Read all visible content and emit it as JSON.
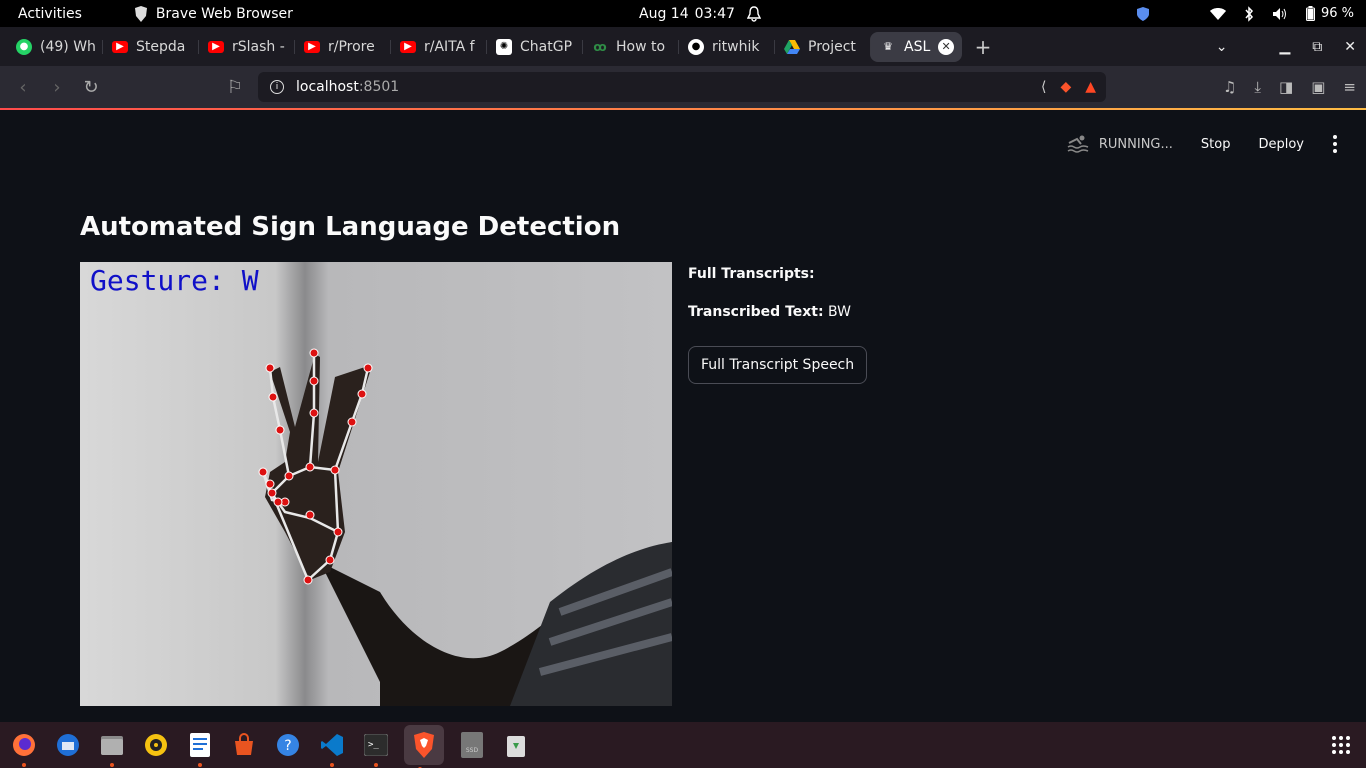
{
  "topbar": {
    "activities": "Activities",
    "app_name": "Brave Web Browser",
    "date": "Aug 14",
    "time": "03:47",
    "battery": "96 %"
  },
  "tabs": [
    {
      "label": "(49) Wh",
      "icon": "whatsapp-icon",
      "color": "#25d366"
    },
    {
      "label": "Stepda",
      "icon": "youtube-icon",
      "color": "#ff0000"
    },
    {
      "label": "rSlash -",
      "icon": "youtube-icon",
      "color": "#ff0000"
    },
    {
      "label": "r/Prore",
      "icon": "youtube-icon",
      "color": "#ff0000"
    },
    {
      "label": "r/AITA f",
      "icon": "youtube-icon",
      "color": "#ff0000"
    },
    {
      "label": "ChatGP",
      "icon": "chatgpt-icon",
      "color": "#ffffff"
    },
    {
      "label": "How to",
      "icon": "geeksforgeeks-icon",
      "color": "#2f8d46"
    },
    {
      "label": "ritwhik",
      "icon": "github-icon",
      "color": "#ffffff"
    },
    {
      "label": "Project",
      "icon": "google-drive-icon",
      "color": "#fbbc04"
    },
    {
      "label": "ASL",
      "icon": "streamlit-icon",
      "color": "#ffffff",
      "active": true
    }
  ],
  "address": {
    "host": "localhost",
    "port": ":8501"
  },
  "streamlit": {
    "status": "RUNNING...",
    "stop": "Stop",
    "deploy": "Deploy"
  },
  "main": {
    "title": "Automated Sign Language Detection",
    "gesture_overlay": "Gesture: W",
    "full_transcripts_label": "Full Transcripts:",
    "transcribed_label": "Transcribed Text:",
    "transcribed_value": "BW",
    "speech_button": "Full Transcript Speech"
  },
  "dock": [
    {
      "name": "firefox-icon",
      "running": true
    },
    {
      "name": "thunderbird-icon",
      "running": false
    },
    {
      "name": "files-icon",
      "running": true
    },
    {
      "name": "rhythmbox-icon",
      "running": false
    },
    {
      "name": "libreoffice-writer-icon",
      "running": true
    },
    {
      "name": "app-center-icon",
      "running": false
    },
    {
      "name": "help-icon",
      "running": false
    },
    {
      "name": "vscode-icon",
      "running": true
    },
    {
      "name": "terminal-icon",
      "running": true
    },
    {
      "name": "brave-icon",
      "running": true,
      "focused": true
    },
    {
      "name": "disk-icon",
      "running": false
    },
    {
      "name": "trash-icon",
      "running": false
    }
  ]
}
